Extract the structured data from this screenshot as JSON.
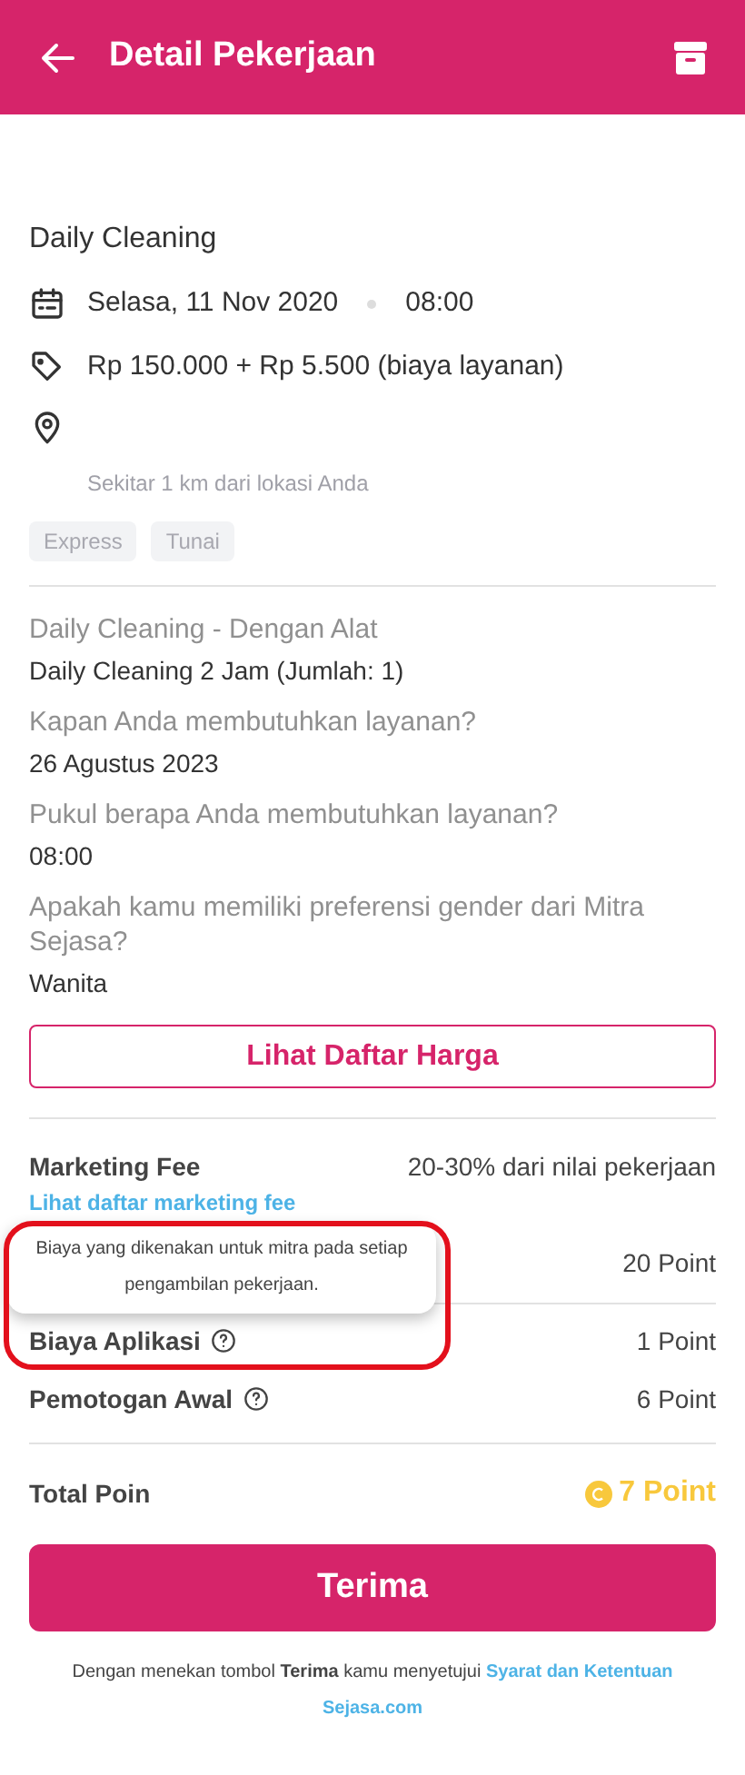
{
  "header": {
    "title": "Detail Pekerjaan"
  },
  "job": {
    "title": "Daily Cleaning",
    "date": "Selasa, 11 Nov 2020",
    "time": "08:00",
    "price": "Rp 150.000 + Rp 5.500 (biaya layanan)",
    "distance": "Sekitar 1 km dari lokasi Anda",
    "tags": [
      "Express",
      "Tunai"
    ]
  },
  "details": [
    {
      "question": "Daily Cleaning - Dengan Alat",
      "answer": "Daily Cleaning 2 Jam (Jumlah: 1)"
    },
    {
      "question": "Kapan Anda membutuhkan layanan?",
      "answer": "26 Agustus 2023"
    },
    {
      "question": "Pukul berapa Anda membutuhkan layanan?",
      "answer": "08:00"
    },
    {
      "question": "Apakah kamu memiliki preferensi gender dari Mitra Sejasa?",
      "answer": "Wanita"
    }
  ],
  "price_list_button": "Lihat Daftar Harga",
  "marketing_fee": {
    "label": "Marketing Fee",
    "value": "20-30% dari nilai pekerjaan",
    "link": "Lihat daftar marketing fee"
  },
  "fee_rows": [
    {
      "value": "20 Point",
      "info": false
    },
    {
      "label": "Biaya Aplikasi",
      "value": "1 Point",
      "info": true
    },
    {
      "label": "Pemotogan Awal",
      "value": "6 Point",
      "info": true
    }
  ],
  "tooltip": {
    "text": "Biaya yang dikenakan untuk mitra pada setiap pengambilan pekerjaan."
  },
  "total": {
    "label": "Total Poin",
    "value": "7 Point"
  },
  "accept_button": "Terima",
  "terms": {
    "text": "Dengan menekan tombol **Terima** kamu menyetujui",
    "links": [
      "Syarat dan Ketentuan",
      "Sejasa.com"
    ]
  }
}
